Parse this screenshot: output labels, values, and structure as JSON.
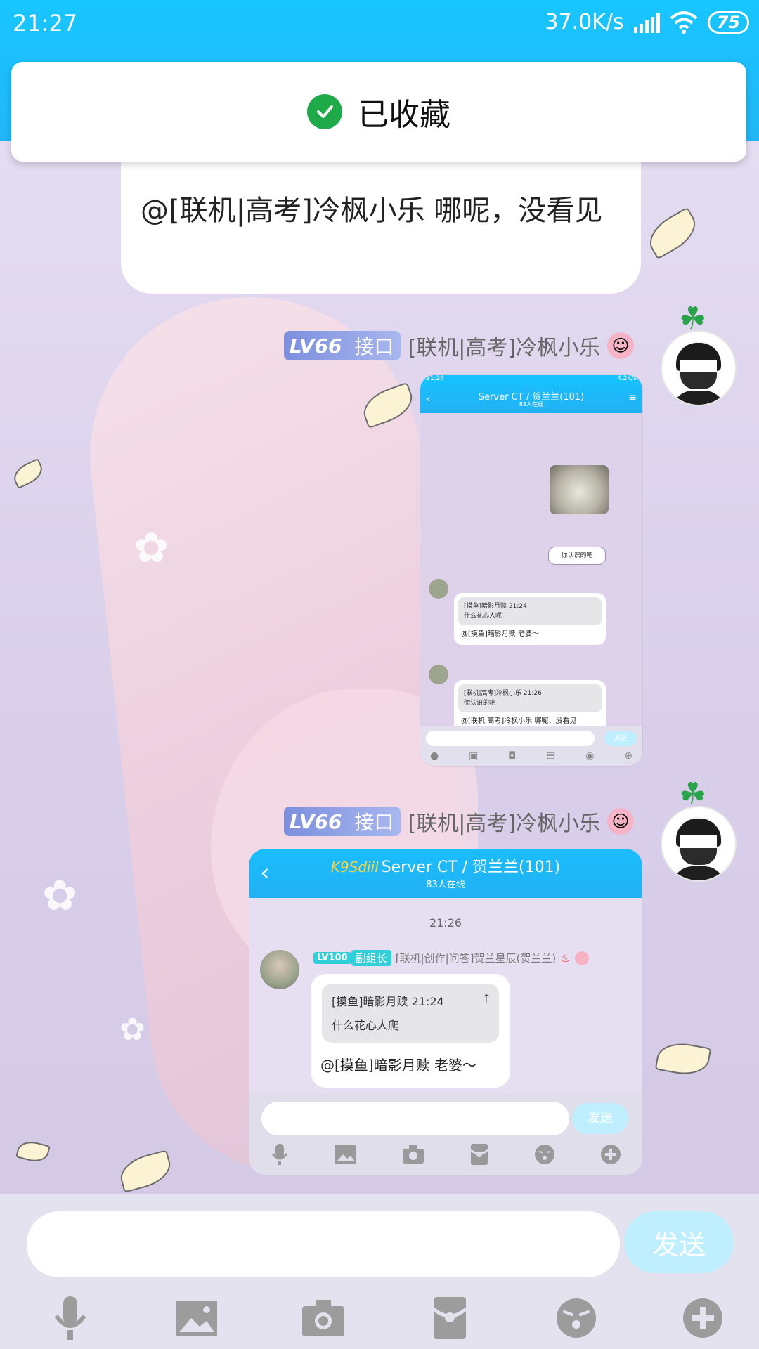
{
  "status_bar": {
    "time": "21:27",
    "speed": "37.0K/s",
    "battery": "75"
  },
  "toast": {
    "text": "已收藏"
  },
  "messages": [
    {
      "type": "text",
      "text": "@[联机|高考]冷枫小乐 哪呢，没看见"
    },
    {
      "type": "image",
      "level": "LV66",
      "role": "接口",
      "sender": "[联机|高考]冷枫小乐"
    },
    {
      "type": "image",
      "level": "LV66",
      "role": "接口",
      "sender": "[联机|高考]冷枫小乐"
    }
  ],
  "shot1": {
    "status_time": "21:26",
    "status_right": "4.2K/s",
    "title": "Server CT / 贺兰兰(101)",
    "online": "83人在线",
    "sticker_text": "你认识的吧",
    "quote1_a": "[摸鱼]暗影月赎 21:24",
    "quote1_b": "什么花心人呢",
    "msg1": "@[摸鱼]暗影月赎 老婆～",
    "quote2_a": "[联机|高考]冷枫小乐 21:26",
    "quote2_b": "你认识的吧",
    "msg2": "@[联机|高考]冷枫小乐 哪呢，没看见",
    "send": "发送"
  },
  "shot2": {
    "title_prefix": "K9Sdiil",
    "title": "Server CT / 贺兰兰(101)",
    "online": "83人在线",
    "time": "21:26",
    "level": "LV100",
    "role": "副组长",
    "sender": "[联机|创作|问答]贺兰星辰(贺兰兰)",
    "quote_a": "[摸鱼]暗影月赎 21:24",
    "quote_b": "什么花心人爬",
    "message": "@[摸鱼]暗影月赎 老婆～",
    "send": "发送"
  },
  "input_bar": {
    "value": "",
    "send": "发送"
  },
  "toolbar": {
    "icons": [
      "microphone-icon",
      "image-icon",
      "camera-icon",
      "red-packet-icon",
      "emoji-icon",
      "plus-icon"
    ]
  }
}
